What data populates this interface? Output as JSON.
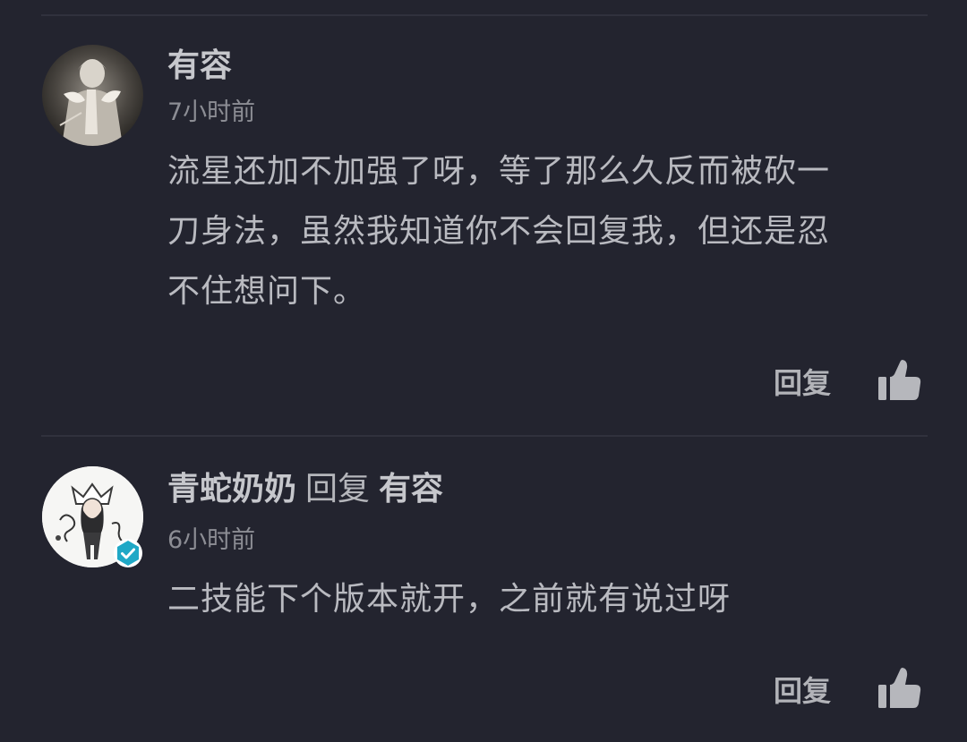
{
  "comments": [
    {
      "author": "有容",
      "time": "7小时前",
      "lines": [
        "流星还加不加强了呀，等了那么久反而被砍一",
        "刀身法，虽然我知道你不会回复我，但还是忍",
        "不住想问下。"
      ],
      "reply_label": "回复",
      "avatar_icon": "user-avatar-illustration",
      "like_icon": "thumbs-up-icon"
    },
    {
      "author": "青蛇奶奶",
      "reply_word": "回复",
      "reply_target": "有容",
      "time": "6小时前",
      "lines": [
        "二技能下个版本就开，之前就有说过呀"
      ],
      "reply_label": "回复",
      "avatar_icon": "user-avatar-illustration",
      "verified_icon": "verified-check-icon",
      "like_icon": "thumbs-up-icon"
    }
  ],
  "colors": {
    "background": "#23242f",
    "divider": "#30313d",
    "author": "#c6c7cc",
    "body_text": "#b9bac0",
    "time": "#8c8d94",
    "verified": "#1fa8c6"
  }
}
